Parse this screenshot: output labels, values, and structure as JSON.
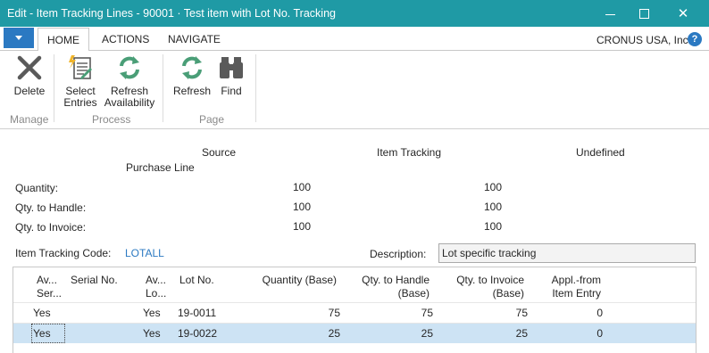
{
  "window": {
    "title": "Edit - Item Tracking Lines - 90001 · Test item with Lot No. Tracking",
    "minimize_icon": "minimize-icon",
    "maximize_icon": "maximize-icon",
    "close_glyph": "✕"
  },
  "tabs": {
    "app_menu_icon": "dropdown-arrow-icon",
    "home": "HOME",
    "actions": "ACTIONS",
    "navigate": "NAVIGATE",
    "company": "CRONUS USA, Inc.",
    "help": "?"
  },
  "ribbon": {
    "groups": [
      {
        "label": "Manage",
        "buttons": [
          {
            "label1": "Delete",
            "label2": "",
            "icon": "delete-x-icon"
          }
        ]
      },
      {
        "label": "Process",
        "buttons": [
          {
            "label1": "Select",
            "label2": "Entries",
            "icon": "select-entries-icon"
          },
          {
            "label1": "Refresh",
            "label2": "Availability",
            "icon": "refresh-icon"
          }
        ]
      },
      {
        "label": "Page",
        "buttons": [
          {
            "label1": "Refresh",
            "label2": "",
            "icon": "refresh-icon"
          },
          {
            "label1": "Find",
            "label2": "",
            "icon": "binoculars-icon"
          }
        ]
      }
    ],
    "accent_green": "#4a9e77",
    "accent_grey": "#5a5a5a"
  },
  "summary": {
    "col_source": "Source",
    "col_source_sub": "Purchase Line",
    "col_item_tracking": "Item Tracking",
    "col_undefined": "Undefined",
    "rows": [
      {
        "label": "Quantity:",
        "source": "100",
        "tracking": "100"
      },
      {
        "label": "Qty. to Handle:",
        "source": "100",
        "tracking": "100"
      },
      {
        "label": "Qty. to Invoice:",
        "source": "100",
        "tracking": "100"
      }
    ]
  },
  "fields": {
    "item_tracking_code_label": "Item Tracking Code:",
    "item_tracking_code_value": "LOTALL",
    "description_label": "Description:",
    "description_value": "Lot specific tracking"
  },
  "grid": {
    "headers": {
      "avail_serial_1": "Av...",
      "avail_serial_2": "Ser...",
      "serial_no": "Serial No.",
      "avail_lot_1": "Av...",
      "avail_lot_2": "Lo...",
      "lot_no": "Lot No.",
      "quantity": "Quantity (Base)",
      "qty_handle_1": "Qty. to Handle",
      "qty_handle_2": "(Base)",
      "qty_invoice_1": "Qty. to Invoice",
      "qty_invoice_2": "(Base)",
      "appl_from_1": "Appl.-from",
      "appl_from_2": "Item Entry"
    },
    "rows": [
      {
        "avail_serial": "Yes",
        "serial_no": "",
        "avail_lot": "Yes",
        "lot_no": "19-0011",
        "quantity": "75",
        "qty_handle": "75",
        "qty_invoice": "75",
        "appl_from": "0"
      },
      {
        "avail_serial": "Yes",
        "serial_no": "",
        "avail_lot": "Yes",
        "lot_no": "19-0022",
        "quantity": "25",
        "qty_handle": "25",
        "qty_invoice": "25",
        "appl_from": "0"
      }
    ],
    "selected_row_color": "#cde3f4"
  }
}
